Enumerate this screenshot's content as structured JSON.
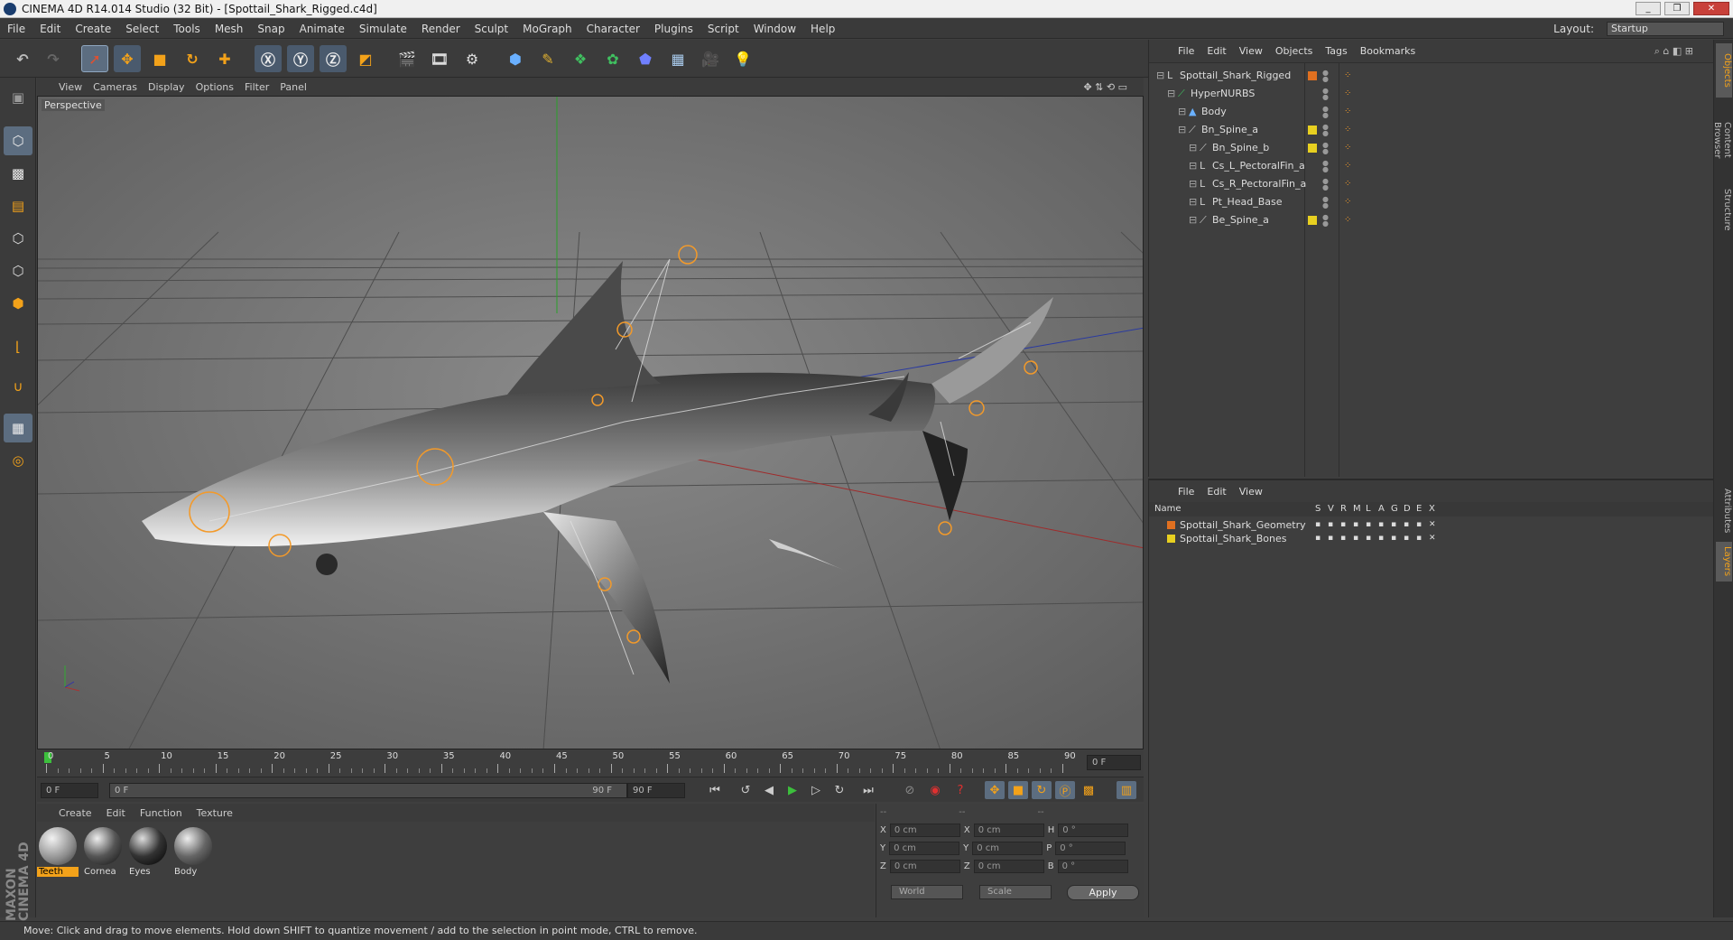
{
  "window": {
    "title": "CINEMA 4D R14.014 Studio (32 Bit) - [Spottail_Shark_Rigged.c4d]",
    "min": "_",
    "max": "❐",
    "close": "✕"
  },
  "menu": [
    "File",
    "Edit",
    "Create",
    "Select",
    "Tools",
    "Mesh",
    "Snap",
    "Animate",
    "Simulate",
    "Render",
    "Sculpt",
    "MoGraph",
    "Character",
    "Plugins",
    "Script",
    "Window",
    "Help"
  ],
  "layout": {
    "label": "Layout:",
    "value": "Startup"
  },
  "viewport": {
    "menu": [
      "View",
      "Cameras",
      "Display",
      "Options",
      "Filter",
      "Panel"
    ],
    "label": "Perspective"
  },
  "timeline": {
    "ticks": [
      "0",
      "5",
      "10",
      "15",
      "20",
      "25",
      "30",
      "35",
      "40",
      "45",
      "50",
      "55",
      "60",
      "65",
      "70",
      "75",
      "80",
      "85",
      "90"
    ],
    "current_frame": "0 F"
  },
  "playbar": {
    "start": "0 F",
    "range_start": "0 F",
    "range_end": "90 F",
    "end": "90 F"
  },
  "materials": {
    "menu": [
      "Create",
      "Edit",
      "Function",
      "Texture"
    ],
    "items": [
      {
        "label": "Teeth",
        "active": true
      },
      {
        "label": "Cornea",
        "active": false
      },
      {
        "label": "Eyes",
        "active": false
      },
      {
        "label": "Body",
        "active": false
      }
    ]
  },
  "coords": {
    "headers": [
      "--",
      "--",
      "--"
    ],
    "rows": [
      {
        "a": "X",
        "av": "0 cm",
        "b": "X",
        "bv": "0 cm",
        "c": "H",
        "cv": "0 °"
      },
      {
        "a": "Y",
        "av": "0 cm",
        "b": "Y",
        "bv": "0 cm",
        "c": "P",
        "cv": "0 °"
      },
      {
        "a": "Z",
        "av": "0 cm",
        "b": "Z",
        "bv": "0 cm",
        "c": "B",
        "cv": "0 °"
      }
    ],
    "space": "World",
    "mode": "Scale",
    "apply": "Apply"
  },
  "objects": {
    "menu": [
      "File",
      "Edit",
      "View",
      "Objects",
      "Tags",
      "Bookmarks"
    ],
    "rows": [
      {
        "name": "Spottail_Shark_Rigged",
        "indent": 0,
        "color": "#e07020"
      },
      {
        "name": "HyperNURBS",
        "indent": 1,
        "color": ""
      },
      {
        "name": "Body",
        "indent": 2,
        "color": ""
      },
      {
        "name": "Bn_Spine_a",
        "indent": 2,
        "color": "#e8d020"
      },
      {
        "name": "Bn_Spine_b",
        "indent": 3,
        "color": "#e8d020"
      },
      {
        "name": "Cs_L_PectoralFin_a",
        "indent": 3,
        "color": ""
      },
      {
        "name": "Cs_R_PectoralFin_a",
        "indent": 3,
        "color": ""
      },
      {
        "name": "Pt_Head_Base",
        "indent": 3,
        "color": ""
      },
      {
        "name": "Be_Spine_a",
        "indent": 3,
        "color": "#e8d020"
      }
    ]
  },
  "layers": {
    "menu": [
      "File",
      "Edit",
      "View"
    ],
    "headers": {
      "name": "Name",
      "flags": [
        "S",
        "V",
        "R",
        "M",
        "L",
        "A",
        "G",
        "D",
        "E",
        "X"
      ]
    },
    "rows": [
      {
        "name": "Spottail_Shark_Geometry",
        "color": "#e07020"
      },
      {
        "name": "Spottail_Shark_Bones",
        "color": "#e8d020"
      }
    ]
  },
  "side_tabs": [
    "Objects",
    "Content Browser",
    "Structure",
    "Attributes",
    "Layers"
  ],
  "branding": "MAXON CINEMA 4D",
  "status": "Move: Click and drag to move elements. Hold down SHIFT to quantize movement / add to the selection in point mode, CTRL to remove."
}
